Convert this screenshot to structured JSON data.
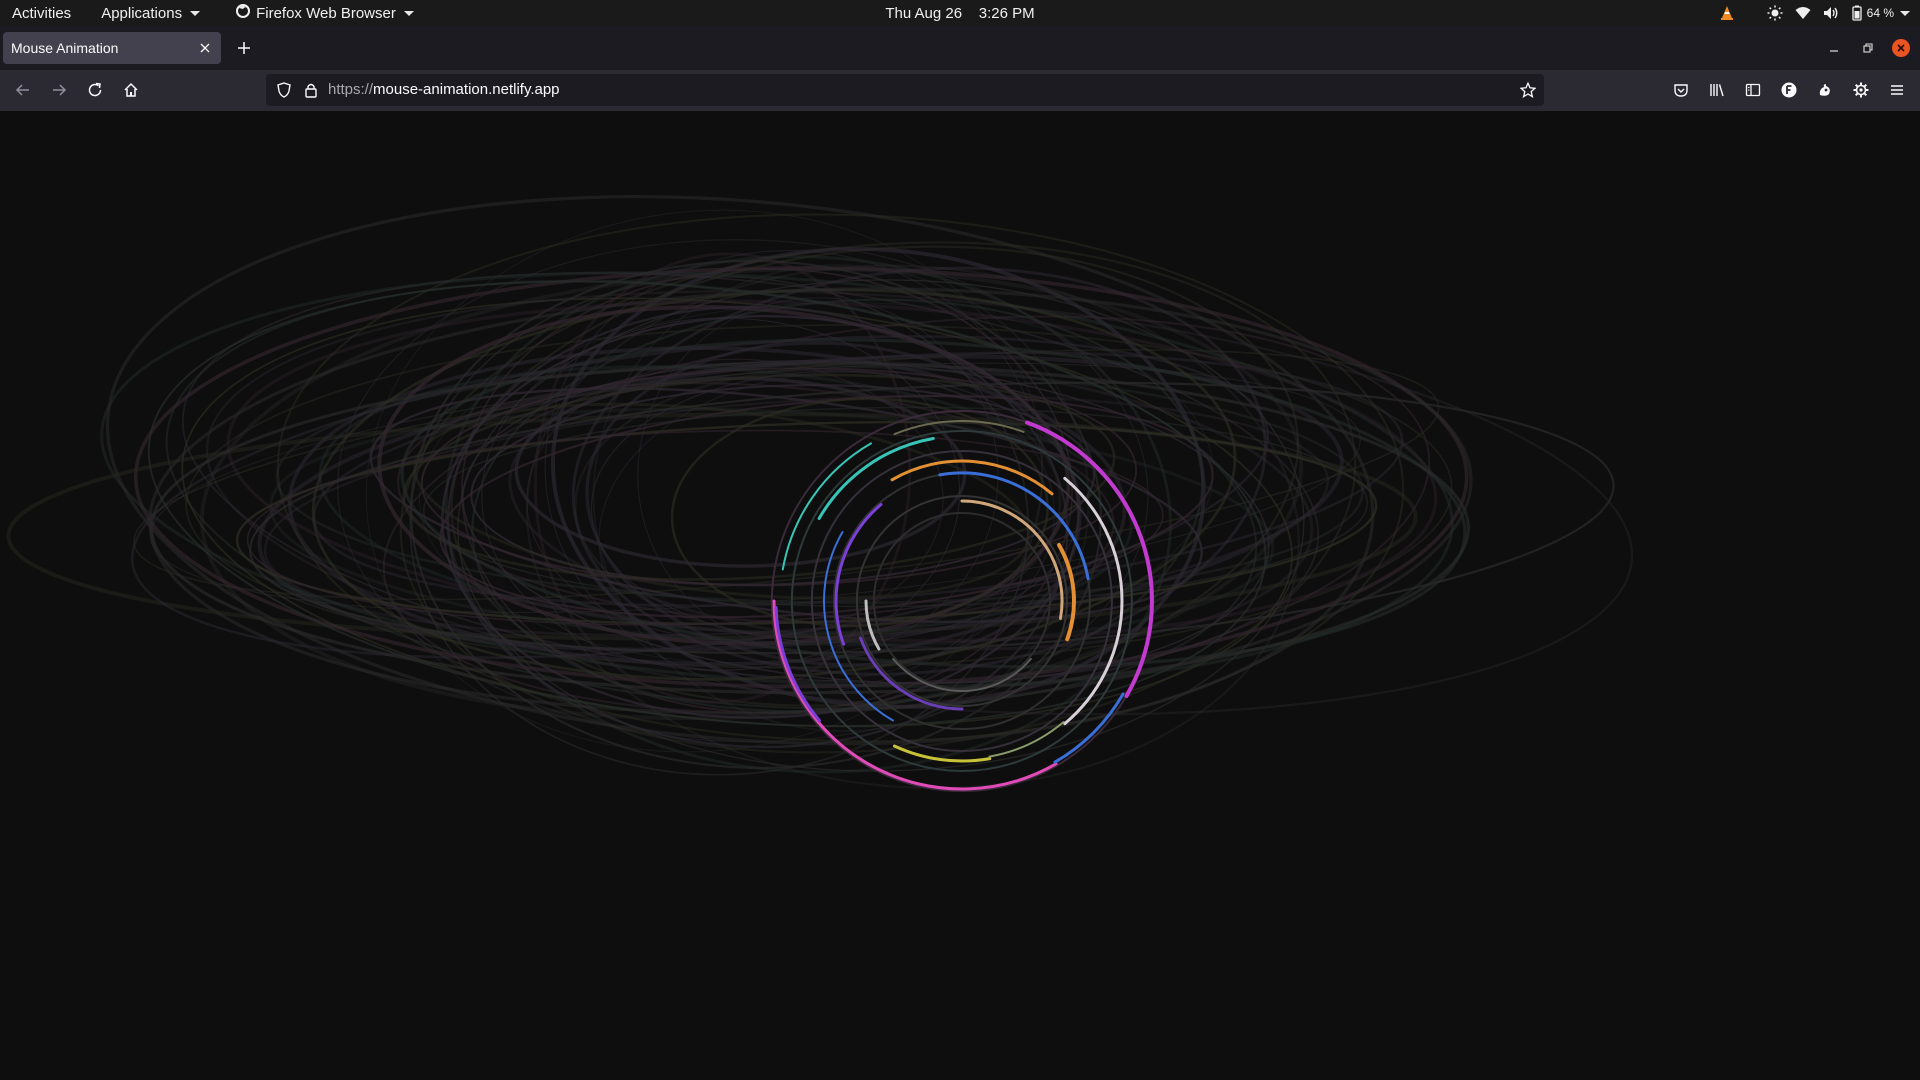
{
  "system_bar": {
    "activities_label": "Activities",
    "applications_label": "Applications",
    "app_menu_label": "Firefox Web Browser",
    "date": "Thu Aug 26",
    "time": "3:26 PM",
    "battery_percent": "64 %"
  },
  "browser": {
    "tab": {
      "title": "Mouse Animation"
    },
    "url": {
      "scheme": "https://",
      "host": "mouse-animation.netlify.app"
    }
  },
  "icons": {
    "top_bar": [
      "vlc-icon",
      "brightness-icon",
      "wifi-icon",
      "volume-icon",
      "battery-icon",
      "system-menu-caret-icon"
    ],
    "tab_bar": [
      "tab-close-icon",
      "new-tab-icon",
      "minimize-icon",
      "restore-icon",
      "window-close-icon"
    ],
    "nav_bar": [
      "back-icon",
      "forward-icon",
      "reload-icon",
      "home-icon",
      "tracking-shield-icon",
      "lock-icon",
      "bookmark-star-icon",
      "pocket-icon",
      "library-icon",
      "sidebar-icon",
      "account-icon",
      "extension-icon",
      "settings-gear-icon",
      "menu-icon"
    ]
  },
  "colors": {
    "page_background": "#0e0e0e",
    "ring_magenta": "#c23ad0",
    "ring_pink": "#e04bb8",
    "ring_cyan": "#39c4b8",
    "ring_blue": "#3b6fd8",
    "ring_orange": "#e29033",
    "ring_yellow": "#c8c23a",
    "ring_purple": "#7a3fd6",
    "ring_white": "#d8d0d8",
    "close_button": "#e95420"
  }
}
